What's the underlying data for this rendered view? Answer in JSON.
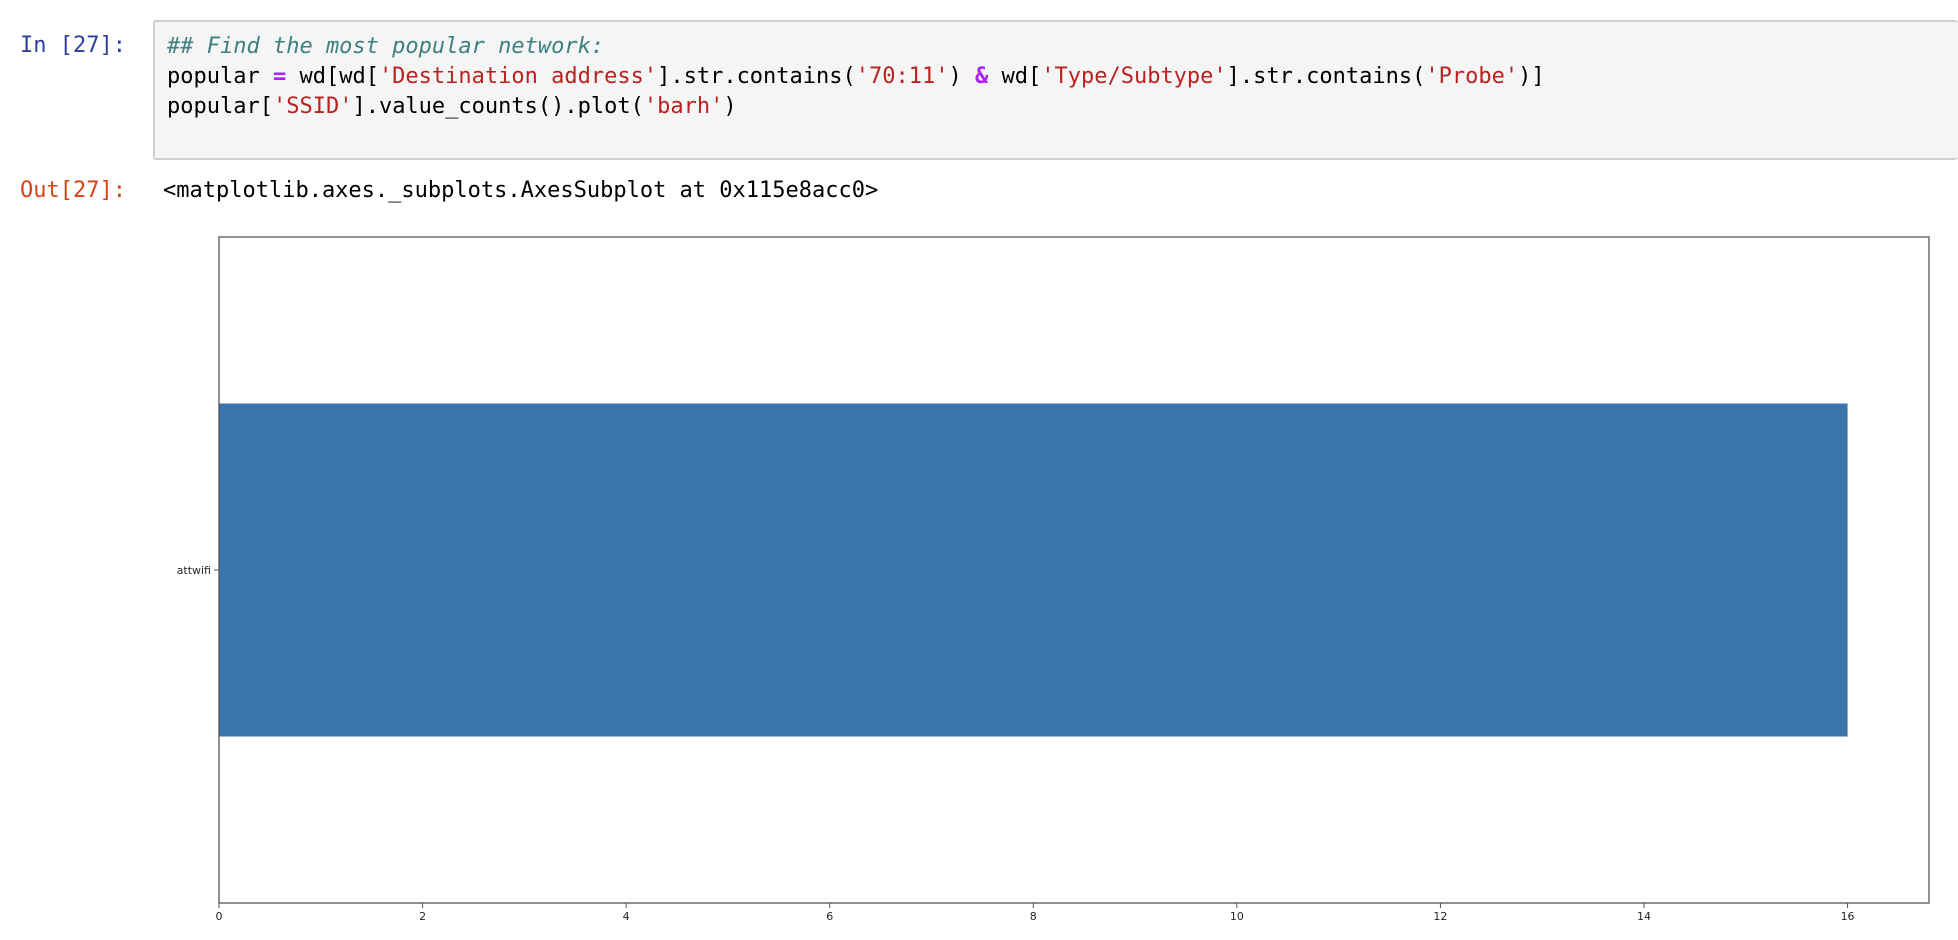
{
  "notebook": {
    "input_prompt": "In [27]:",
    "output_prompt": "Out[27]:",
    "code_lines": [
      [
        {
          "type": "comment",
          "text": "## Find the most popular network:"
        }
      ],
      [
        {
          "type": "plain",
          "text": "popular "
        },
        {
          "type": "op",
          "text": "="
        },
        {
          "type": "plain",
          "text": " wd[wd["
        },
        {
          "type": "str",
          "text": "'Destination address'"
        },
        {
          "type": "plain",
          "text": "].str.contains("
        },
        {
          "type": "str",
          "text": "'70:11'"
        },
        {
          "type": "plain",
          "text": ") "
        },
        {
          "type": "op",
          "text": "&"
        },
        {
          "type": "plain",
          "text": " wd["
        },
        {
          "type": "str",
          "text": "'Type/Subtype'"
        },
        {
          "type": "plain",
          "text": "].str.contains("
        },
        {
          "type": "str",
          "text": "'Probe'"
        },
        {
          "type": "plain",
          "text": ")]"
        }
      ],
      [
        {
          "type": "plain",
          "text": "popular["
        },
        {
          "type": "str",
          "text": "'SSID'"
        },
        {
          "type": "plain",
          "text": "].value_counts().plot("
        },
        {
          "type": "str",
          "text": "'barh'"
        },
        {
          "type": "plain",
          "text": ")"
        }
      ]
    ],
    "output_text": "<matplotlib.axes._subplots.AxesSubplot at 0x115e8acc0>"
  },
  "colors": {
    "bar": "#3a76ab",
    "axes": "#555555"
  },
  "chart_data": {
    "type": "bar",
    "orientation": "horizontal",
    "categories": [
      "attwifi"
    ],
    "values": [
      16
    ],
    "title": "",
    "xlabel": "",
    "ylabel": "",
    "xlim": [
      0,
      16.8
    ],
    "xticks": [
      0,
      2,
      4,
      6,
      8,
      10,
      12,
      14,
      16
    ],
    "grid": false,
    "legend": "none"
  }
}
